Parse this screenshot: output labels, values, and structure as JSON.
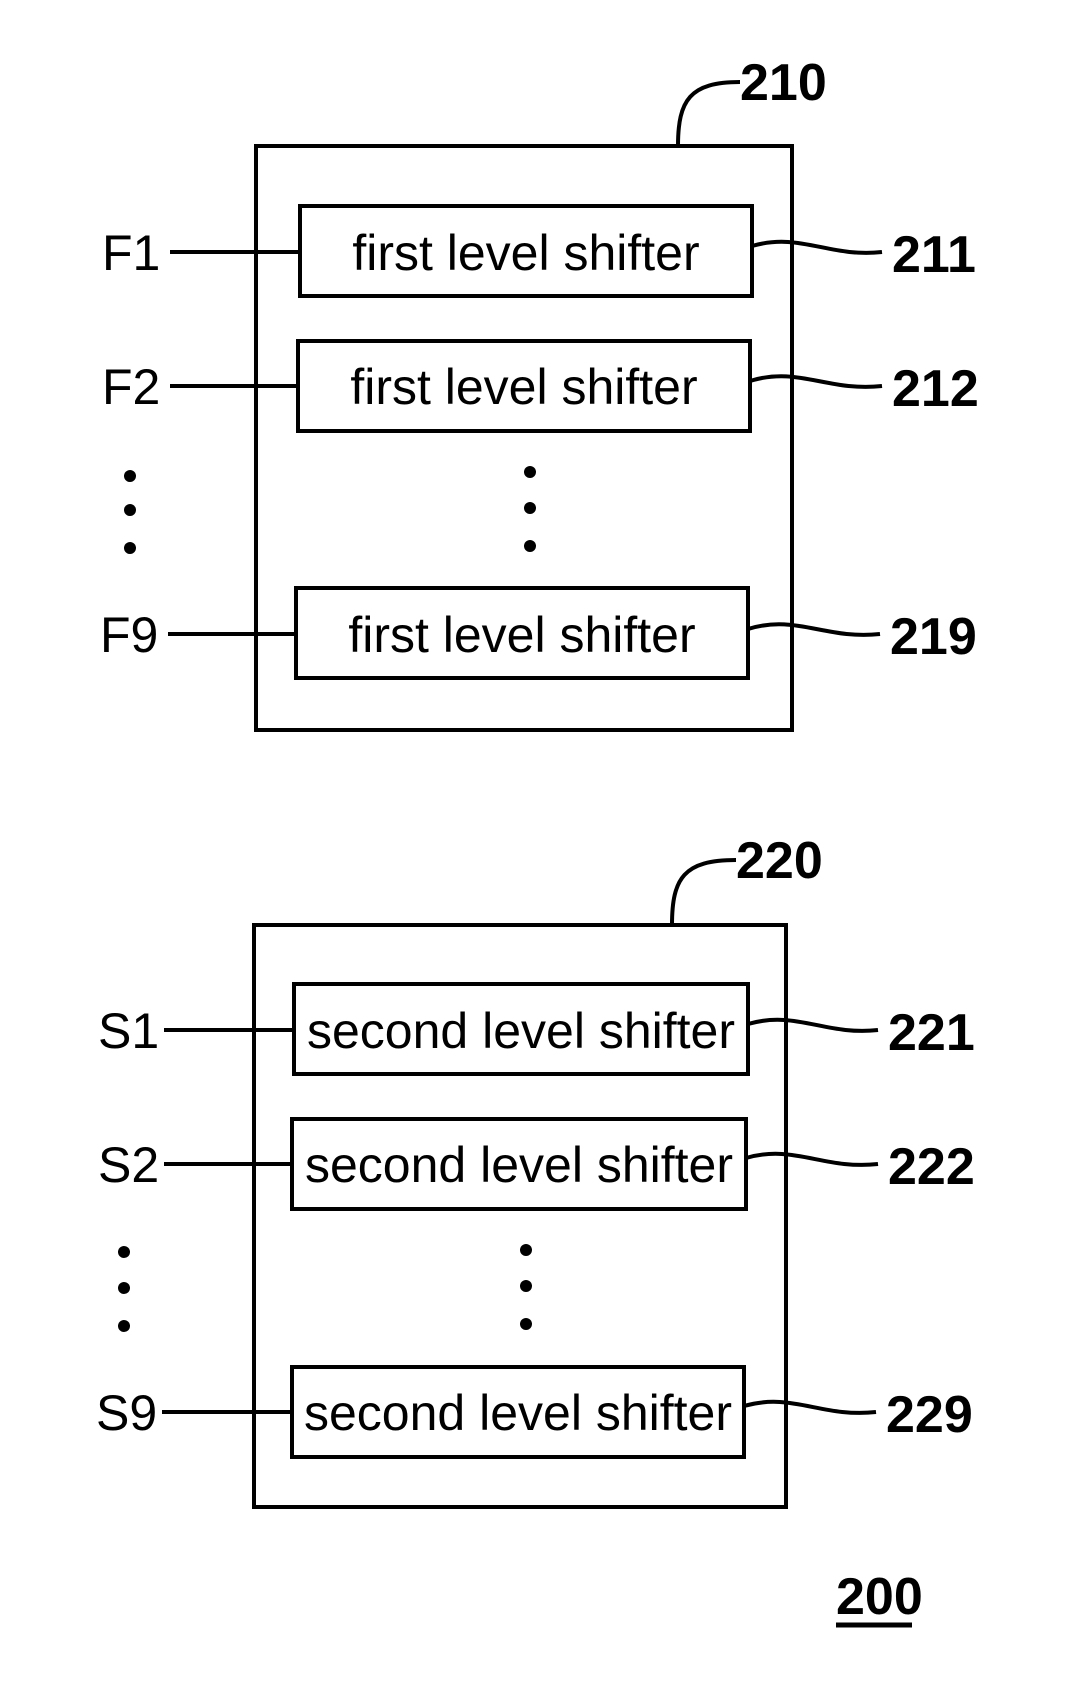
{
  "figure_ref": "200",
  "groups": [
    {
      "ref": "210",
      "rows": [
        {
          "signal": "F1",
          "label": "first level shifter",
          "ref": "211"
        },
        {
          "signal": "F2",
          "label": "first level shifter",
          "ref": "212"
        },
        {
          "signal": "F9",
          "label": "first level shifter",
          "ref": "219"
        }
      ]
    },
    {
      "ref": "220",
      "rows": [
        {
          "signal": "S1",
          "label": "second level shifter",
          "ref": "221"
        },
        {
          "signal": "S2",
          "label": "second level shifter",
          "ref": "222"
        },
        {
          "signal": "S9",
          "label": "second level shifter",
          "ref": "229"
        }
      ]
    }
  ]
}
